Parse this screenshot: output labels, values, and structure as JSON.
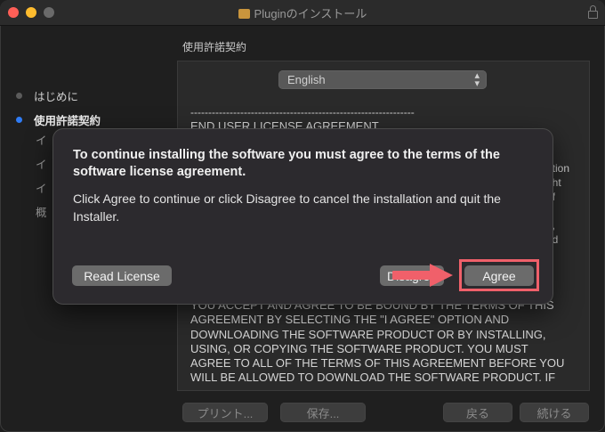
{
  "window": {
    "title": "Pluginのインストール"
  },
  "section_title": "使用許諾契約",
  "sidebar": {
    "items": [
      {
        "label": "はじめに",
        "active": false
      },
      {
        "label": "使用許諾契約",
        "active": true
      },
      {
        "label": "イ",
        "active": false
      },
      {
        "label": "イ",
        "active": false
      },
      {
        "label": "イ",
        "active": false
      },
      {
        "label": "概",
        "active": false
      }
    ]
  },
  "language_select": {
    "value": "English"
  },
  "document": {
    "separator": "---------------------------------------------------------------",
    "heading": "END USER LICENSE AGREEMENT",
    "right_fragments": [
      "ation",
      "ght",
      "of",
      "e",
      "d,",
      "nd"
    ],
    "bottom_lines": [
      "YOU ACCEPT AND AGREE TO BE BOUND BY THE TERMS OF THIS",
      "AGREEMENT BY SELECTING THE \"I AGREE\" OPTION AND",
      "DOWNLOADING THE SOFTWARE PRODUCT OR BY INSTALLING,",
      "USING, OR COPYING THE SOFTWARE PRODUCT. YOU MUST",
      "AGREE TO ALL OF THE TERMS OF THIS AGREEMENT BEFORE YOU",
      "WILL BE ALLOWED TO DOWNLOAD THE SOFTWARE PRODUCT. IF"
    ]
  },
  "footer": {
    "print_label": "プリント...",
    "save_label": "保存...",
    "back_label": "戻る",
    "continue_label": "続ける"
  },
  "dialog": {
    "heading": "To continue installing the software you must agree to the terms of the software license agreement.",
    "body": "Click Agree to continue or click Disagree to cancel the installation and quit the Installer.",
    "read_license_label": "Read License",
    "disagree_label": "Disagree",
    "agree_label": "Agree"
  },
  "colors": {
    "accent_blue": "#2f7cf6",
    "annotation_red": "#f0606a"
  }
}
